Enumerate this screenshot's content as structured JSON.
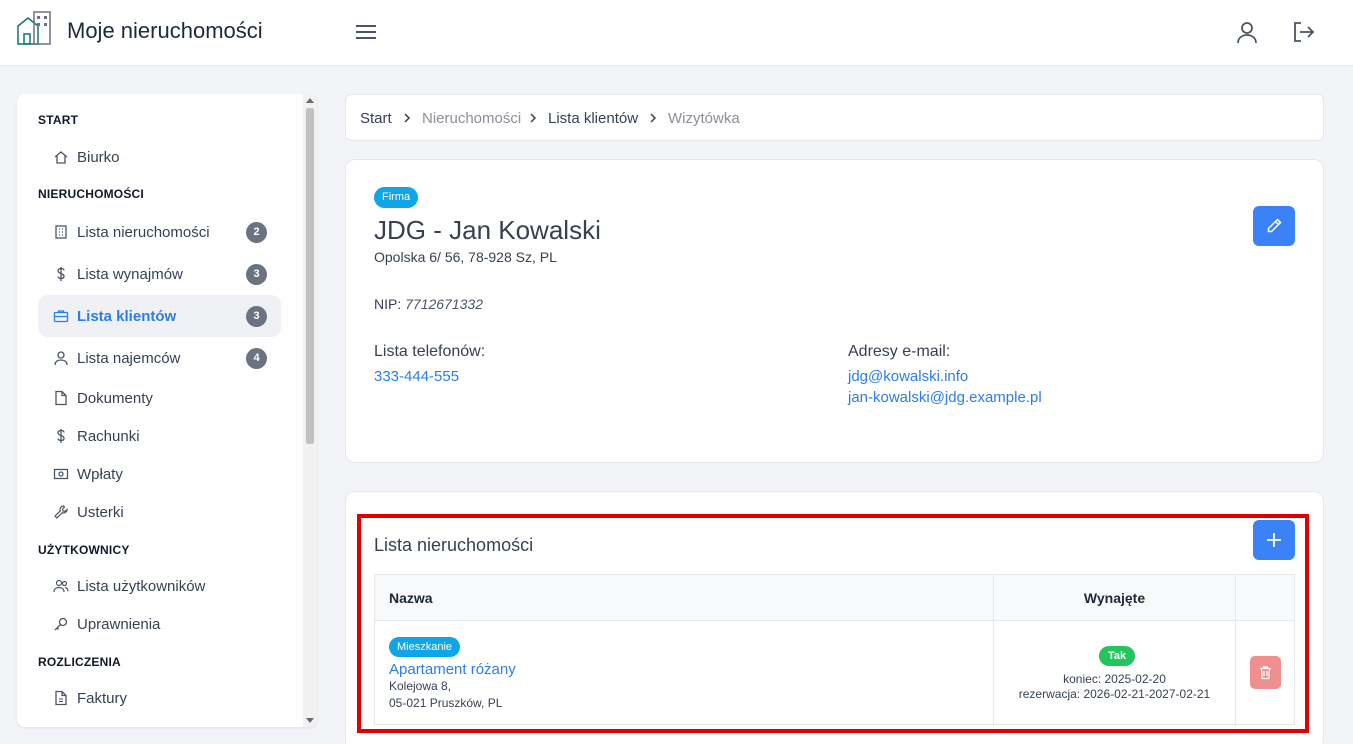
{
  "header": {
    "app_title": "Moje nieruchomości",
    "logo_icon": "building-logo-icon",
    "menu_icon": "hamburger-icon",
    "user_icon": "user-icon",
    "logout_icon": "logout-icon"
  },
  "sidebar": {
    "sections": [
      {
        "title": "START",
        "items": [
          {
            "label": "Biurko",
            "icon": "home-icon"
          }
        ]
      },
      {
        "title": "NIERUCHOMOŚCI",
        "items": [
          {
            "label": "Lista nieruchomości",
            "icon": "building-icon",
            "badge": "2"
          },
          {
            "label": "Lista wynajmów",
            "icon": "dollar-icon",
            "badge": "3"
          },
          {
            "label": "Lista klientów",
            "icon": "briefcase-icon",
            "badge": "3",
            "active": true
          },
          {
            "label": "Lista najemców",
            "icon": "user-icon",
            "badge": "4"
          },
          {
            "label": "Dokumenty",
            "icon": "document-icon"
          },
          {
            "label": "Rachunki",
            "icon": "dollar-icon"
          },
          {
            "label": "Wpłaty",
            "icon": "cash-icon"
          },
          {
            "label": "Usterki",
            "icon": "wrench-icon"
          }
        ]
      },
      {
        "title": "UŻYTKOWNICY",
        "items": [
          {
            "label": "Lista użytkowników",
            "icon": "users-icon"
          },
          {
            "label": "Uprawnienia",
            "icon": "key-icon"
          }
        ]
      },
      {
        "title": "ROZLICZENIA",
        "items": [
          {
            "label": "Faktury",
            "icon": "invoice-icon"
          }
        ]
      }
    ]
  },
  "breadcrumb": [
    "Start",
    "Nieruchomości",
    "Lista klientów",
    "Wizytówka"
  ],
  "client": {
    "type_badge": "Firma",
    "name": "JDG - Jan Kowalski",
    "address": "Opolska 6/ 56, 78-928 Sz, PL",
    "nip_label": "NIP:",
    "nip_value": "7712671332",
    "phones_label": "Lista telefonów:",
    "phones": [
      "333-444-555"
    ],
    "emails_label": "Adresy e-mail:",
    "emails": [
      "jdg@kowalski.info",
      "jan-kowalski@jdg.example.pl"
    ]
  },
  "properties": {
    "title": "Lista nieruchomości",
    "columns": [
      "Nazwa",
      "Wynajęte",
      ""
    ],
    "rows": [
      {
        "type_badge": "Mieszkanie",
        "name": "Apartament różany",
        "address_line1": "Kolejowa 8,",
        "address_line2": "05-021 Pruszków, PL",
        "rented_badge": "Tak",
        "end_line": "koniec: 2025-02-20",
        "reservation_line": "rezerwacja: 2026-02-21-2027-02-21"
      }
    ]
  },
  "colors": {
    "accent": "#3b82f6",
    "link": "#2b7de9",
    "badge_info": "#0ea5e9",
    "badge_success": "#22c55e",
    "danger_soft": "#f08f8f",
    "highlight": "#e00000"
  }
}
